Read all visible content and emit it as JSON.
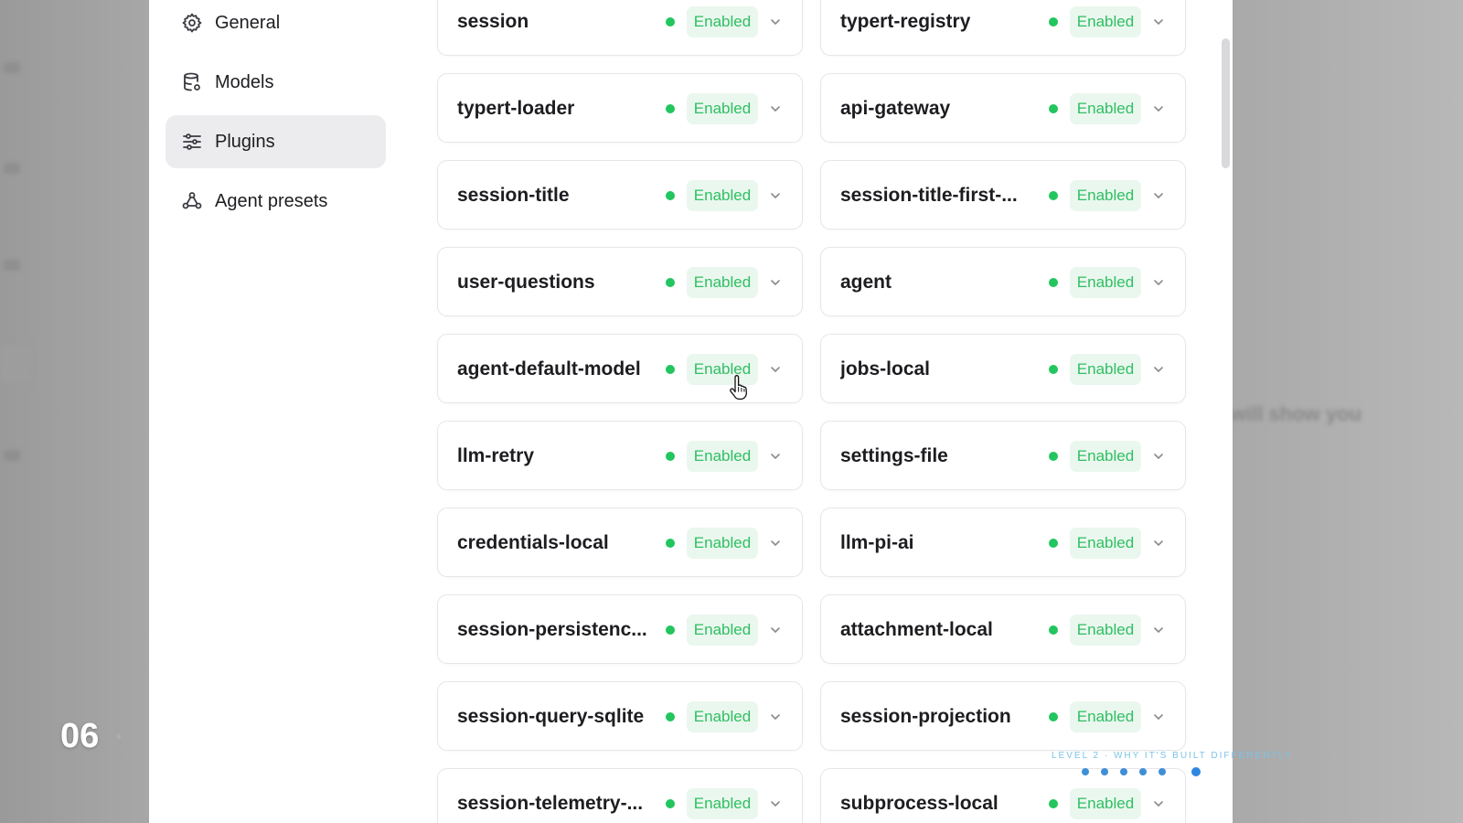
{
  "sidebar": {
    "items": [
      {
        "label": "General",
        "icon": "gear-icon",
        "active": false
      },
      {
        "label": "Models",
        "icon": "database-icon",
        "active": false
      },
      {
        "label": "Plugins",
        "icon": "sliders-icon",
        "active": true
      },
      {
        "label": "Agent presets",
        "icon": "agent-icon",
        "active": false
      }
    ]
  },
  "plugins": {
    "left": [
      {
        "name": "session",
        "status": "Enabled"
      },
      {
        "name": "typert-loader",
        "status": "Enabled"
      },
      {
        "name": "session-title",
        "status": "Enabled"
      },
      {
        "name": "user-questions",
        "status": "Enabled"
      },
      {
        "name": "agent-default-model",
        "status": "Enabled"
      },
      {
        "name": "llm-retry",
        "status": "Enabled"
      },
      {
        "name": "credentials-local",
        "status": "Enabled"
      },
      {
        "name": "session-persistenc...",
        "status": "Enabled"
      },
      {
        "name": "session-query-sqlite",
        "status": "Enabled"
      },
      {
        "name": "session-telemetry-...",
        "status": "Enabled"
      }
    ],
    "right": [
      {
        "name": "typert-registry",
        "status": "Enabled"
      },
      {
        "name": "api-gateway",
        "status": "Enabled"
      },
      {
        "name": "session-title-first-...",
        "status": "Enabled"
      },
      {
        "name": "agent",
        "status": "Enabled"
      },
      {
        "name": "jobs-local",
        "status": "Enabled"
      },
      {
        "name": "settings-file",
        "status": "Enabled"
      },
      {
        "name": "llm-pi-ai",
        "status": "Enabled"
      },
      {
        "name": "attachment-local",
        "status": "Enabled"
      },
      {
        "name": "session-projection",
        "status": "Enabled"
      },
      {
        "name": "subprocess-local",
        "status": "Enabled"
      }
    ]
  },
  "overlay": {
    "slide_number": "06",
    "level_label": "LEVEL 2 · WHY IT'S BUILT DIFFERENTLY",
    "background_text": "will show you",
    "progress_total": 6,
    "progress_current": 6
  },
  "colors": {
    "status_green": "#22c55e",
    "pill_bg": "#eaf7ee",
    "pill_text": "#2fbf62",
    "active_nav_bg": "#ececee"
  }
}
